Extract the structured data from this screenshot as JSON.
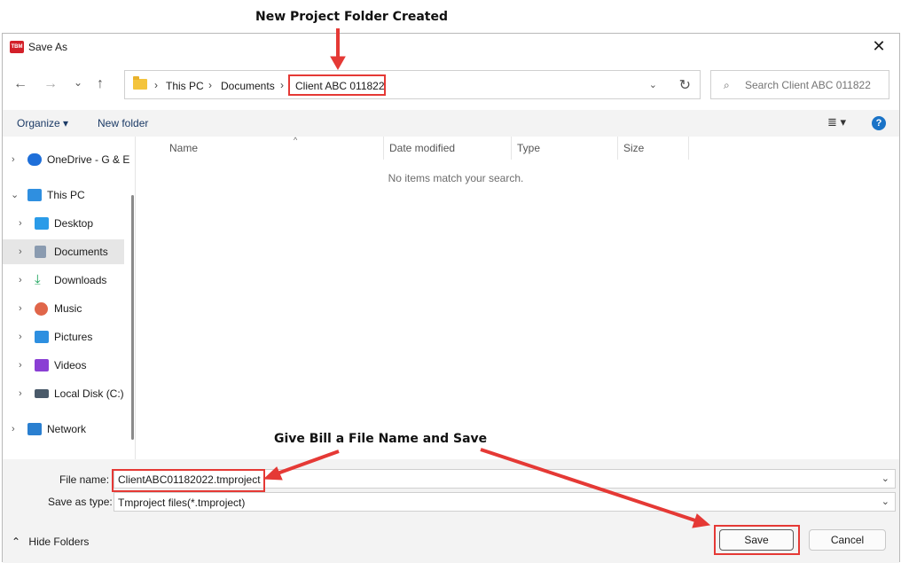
{
  "annotations": {
    "top_callout": "New Project Folder Created",
    "bottom_callout": "Give Bill a File Name and Save"
  },
  "window": {
    "app_icon_text": "TBM",
    "title": "Save As",
    "close": "✕"
  },
  "navigation": {
    "back": "←",
    "forward": "→",
    "recent": "⌄",
    "up": "↑"
  },
  "address_bar": {
    "crumbs": [
      "This PC",
      "Documents",
      "Client ABC 011822"
    ],
    "separator": "›",
    "dropdown": "⌄",
    "refresh": "↻"
  },
  "search": {
    "icon": "⌕",
    "placeholder": "Search Client ABC 011822"
  },
  "command_bar": {
    "organize": "Organize ▾",
    "new_folder": "New folder",
    "view_icon": "≣ ▾",
    "help_icon": "?"
  },
  "nav_pane": {
    "items": [
      {
        "label": "OneDrive - G & E",
        "icon": "cloud-icon",
        "color": "#1e6fd9"
      },
      {
        "label": "This PC",
        "icon": "monitor-icon",
        "color": "#2f8fe0"
      },
      {
        "label": "Desktop",
        "icon": "desktop-icon",
        "color": "#2a9be8"
      },
      {
        "label": "Documents",
        "icon": "documents-icon",
        "color": "#8a9bb0"
      },
      {
        "label": "Downloads",
        "icon": "download-icon",
        "color": "#1aa35a"
      },
      {
        "label": "Music",
        "icon": "music-icon",
        "color": "#e0664a"
      },
      {
        "label": "Pictures",
        "icon": "pictures-icon",
        "color": "#2d8fe0"
      },
      {
        "label": "Videos",
        "icon": "videos-icon",
        "color": "#8a3fd4"
      },
      {
        "label": "Local Disk (C:)",
        "icon": "disk-icon",
        "color": "#4a5a6a"
      },
      {
        "label": "Network",
        "icon": "network-icon",
        "color": "#2a7fd0"
      }
    ],
    "chevron_collapsed": "›",
    "chevron_expanded": "⌄",
    "selected": "Documents"
  },
  "file_list": {
    "columns": [
      "Name",
      "Date modified",
      "Type",
      "Size"
    ],
    "sort_indicator": "^",
    "empty_message": "No items match your search."
  },
  "bottom_panel": {
    "file_name_label": "File name:",
    "file_name_value": "ClientABC01182022.tmproject",
    "save_as_type_label": "Save as type:",
    "save_as_type_value": "Tmproject files(*.tmproject)",
    "dropdown": "⌄",
    "hide_folders": "Hide Folders",
    "hide_folders_icon": "⌃",
    "save_button": "Save",
    "cancel_button": "Cancel"
  },
  "colors": {
    "highlight": "#e53935",
    "accent": "#1a73c7"
  }
}
